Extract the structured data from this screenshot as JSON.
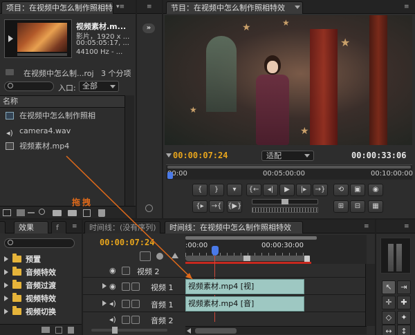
{
  "project": {
    "tab_title": "项目：在视频中怎么制作照相特",
    "clip_name": "视频素材.m...",
    "clip_info_1": "影片，1920 x ...",
    "clip_info_2": "00:05:05:17, ...",
    "clip_info_3": "44100 Hz - ...",
    "project_file": "在视频中怎么制...roj",
    "item_count": "3 个分项",
    "entry_label": "入口:",
    "entry_value": "全部",
    "name_header": "名称",
    "items": [
      {
        "name": "在视频中怎么制作照相",
        "icon": "sequence-icon"
      },
      {
        "name": "camera4.wav",
        "icon": "audio-icon"
      },
      {
        "name": "视频素材.mp4",
        "icon": "video-file-icon"
      }
    ]
  },
  "program": {
    "tab_title": "节目：在视频中怎么制作照相特效",
    "current_time": "00:00:07:24",
    "fit_label": "适配",
    "duration": "00:00:33:06",
    "ruler": [
      "00:00",
      "00:05:00:00",
      "00:10:00:00"
    ]
  },
  "annotation": {
    "drag_label": "拖拽"
  },
  "effects": {
    "tab_title": "效果",
    "tab_title_2": "f",
    "items": [
      "预置",
      "音频特效",
      "音频过渡",
      "视频特效",
      "视频切换"
    ]
  },
  "timeline": {
    "tab_inactive": "时间线：(没有序列)",
    "tab_active": "时间线：在视频中怎么制作照相特效",
    "current_time": "00:00:07:24",
    "ruler": [
      ":00:00",
      "00:00:30:00"
    ],
    "tracks": [
      {
        "label": "视频 2",
        "type": "video"
      },
      {
        "label": "视频 1",
        "type": "video",
        "clip": "视频素材.mp4 [视]"
      },
      {
        "label": "音频 1",
        "type": "audio",
        "clip": "视频素材.mp4 [音]"
      },
      {
        "label": "音频 2",
        "type": "audio"
      }
    ]
  },
  "colors": {
    "timecode": "#e8a51c",
    "clip": "#9ec8c2",
    "annotation": "#e06a1a"
  }
}
